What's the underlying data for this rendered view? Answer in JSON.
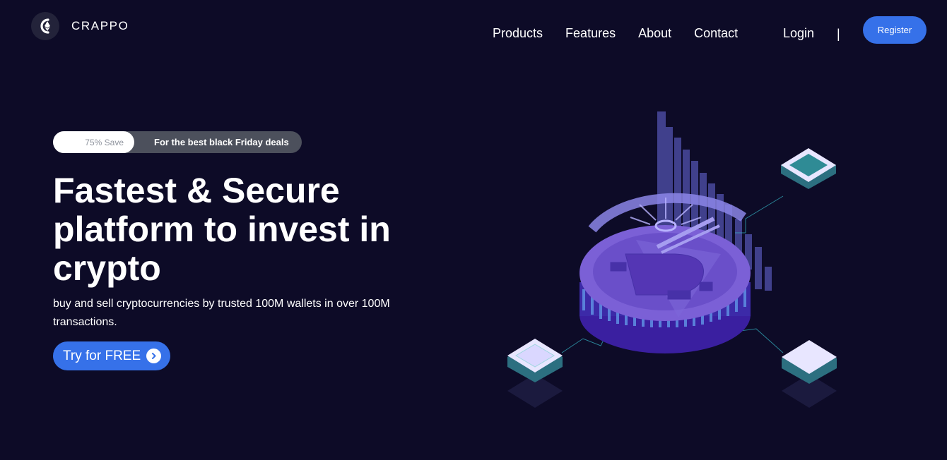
{
  "brand": {
    "name": "CRAPPO",
    "logo_icon": "crypto-logo-icon"
  },
  "nav": {
    "items": [
      {
        "label": "Products"
      },
      {
        "label": "Features"
      },
      {
        "label": "About"
      },
      {
        "label": "Contact"
      }
    ],
    "login_label": "Login",
    "divider": "|",
    "register_label": "Register"
  },
  "hero": {
    "promo": {
      "save_label": "75% Save",
      "deal_label": "For the best black Friday deals"
    },
    "headline": "Fastest & Secure platform to invest in crypto",
    "subtext": "buy and sell cryptocurrencies by trusted 100M wallets in over 100M transactions.",
    "cta_label": "Try for FREE",
    "cta_icon": "chevron-right-icon",
    "illustration": "bitcoin-coin-illustration"
  },
  "colors": {
    "background": "#0d0b27",
    "accent": "#3671e9",
    "promo_bg": "#4c505c",
    "coin": "#7b60d6"
  }
}
